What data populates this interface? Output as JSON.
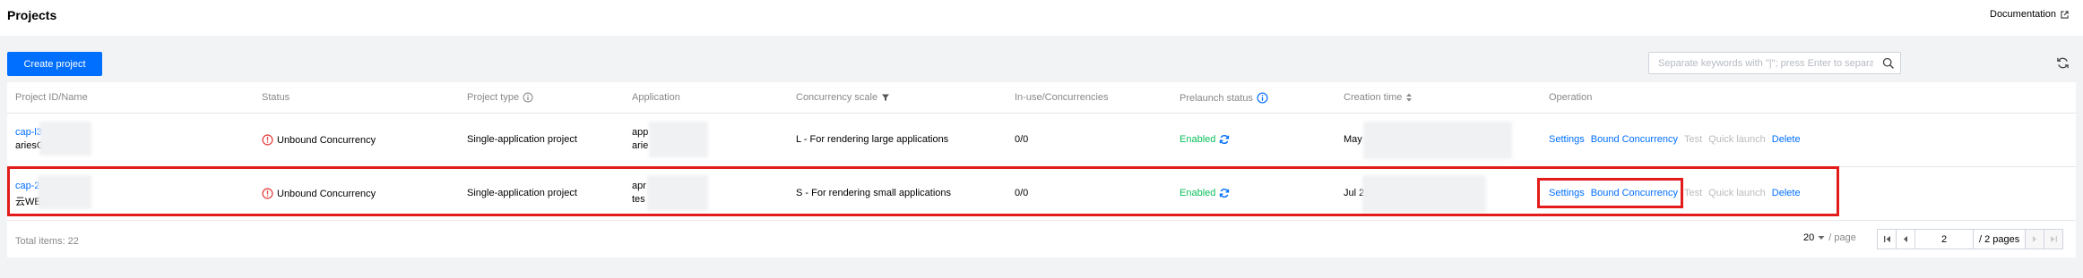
{
  "header": {
    "title": "Projects",
    "doc_link": "Documentation"
  },
  "toolbar": {
    "create_label": "Create project",
    "search_placeholder": "Separate keywords with \"|\"; press Enter to separate filter tags"
  },
  "table": {
    "columns": {
      "project": "Project ID/Name",
      "status": "Status",
      "type": "Project type",
      "application": "Application",
      "scale": "Concurrency scale",
      "inuse": "In-use/Concurrencies",
      "prelaunch": "Prelaunch status",
      "created": "Creation time",
      "operation": "Operation"
    },
    "rows": [
      {
        "id": "cap-l3c",
        "name": "ariesGr",
        "status": "Unbound Concurrency",
        "type": "Single-application project",
        "app_line1": "app",
        "app_line2": "arie",
        "scale": "L - For rendering large applications",
        "inuse": "0/0",
        "prelaunch": "Enabled",
        "created": "May",
        "ops": {
          "settings": "Settings",
          "bound": "Bound Concurrency",
          "test": "Test",
          "quick": "Quick launch",
          "delete": "Delete"
        }
      },
      {
        "id": "cap-2c",
        "name": "云WEB",
        "status": "Unbound Concurrency",
        "type": "Single-application project",
        "app_line1": "apr",
        "app_line2": "tes",
        "scale": "S - For rendering small applications",
        "inuse": "0/0",
        "prelaunch": "Enabled",
        "created": "Jul 2",
        "ops": {
          "settings": "Settings",
          "bound": "Bound Concurrency",
          "test": "Test",
          "quick": "Quick launch",
          "delete": "Delete"
        }
      }
    ]
  },
  "footer": {
    "total": "Total items:  22",
    "page_size": "20",
    "page_unit": "/ page",
    "current_page": "2",
    "total_pages": "/ 2 pages"
  }
}
